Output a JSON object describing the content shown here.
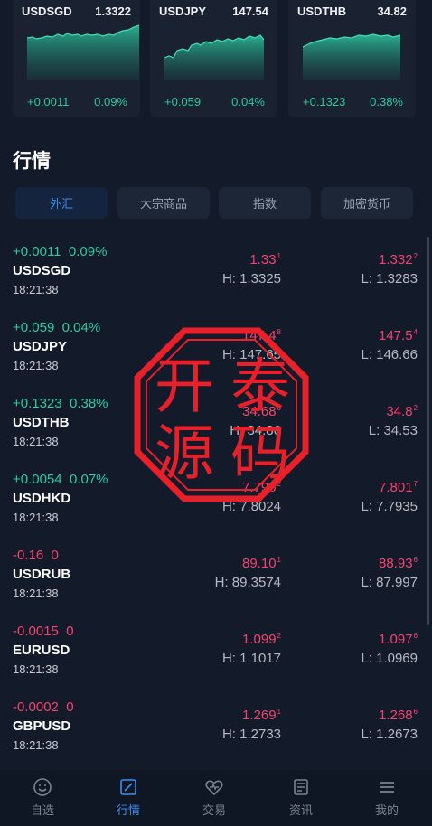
{
  "cards": [
    {
      "symbol": "USDSGD",
      "price": "1.3322",
      "change": "+0.0011",
      "percent": "0.09%"
    },
    {
      "symbol": "USDJPY",
      "price": "147.54",
      "change": "+0.059",
      "percent": "0.04%"
    },
    {
      "symbol": "USDTHB",
      "price": "34.82",
      "change": "+0.1323",
      "percent": "0.38%"
    }
  ],
  "section_title": "行情",
  "tabs": [
    "外汇",
    "大宗商品",
    "指数",
    "加密货币"
  ],
  "rows": [
    {
      "change": "+0.0011",
      "percent": "0.09%",
      "symbol": "USDSGD",
      "time": "18:21:38",
      "bid": "1.33",
      "bid_sup": "1",
      "ask": "1.332",
      "ask_sup": "2",
      "high": "H: 1.3325",
      "low": "L: 1.3283"
    },
    {
      "change": "+0.059",
      "percent": "0.04%",
      "symbol": "USDJPY",
      "time": "18:21:38",
      "bid": "147.4",
      "bid_sup": "8",
      "ask": "147.5",
      "ask_sup": "4",
      "high": "H: 147.65",
      "low": "L: 146.66"
    },
    {
      "change": "+0.1323",
      "percent": "0.38%",
      "symbol": "USDTHB",
      "time": "18:21:38",
      "bid": "34.68",
      "bid_sup": "8",
      "ask": "34.8",
      "ask_sup": "2",
      "high": "H: 34.86",
      "low": "L: 34.53"
    },
    {
      "change": "+0.0054",
      "percent": "0.07%",
      "symbol": "USDHKD",
      "time": "18:21:38",
      "bid": "7.796",
      "bid_sup": "2",
      "ask": "7.801",
      "ask_sup": "7",
      "high": "H: 7.8024",
      "low": "L: 7.7935"
    },
    {
      "change": "-0.16",
      "percent": "0",
      "symbol": "USDRUB",
      "time": "18:21:38",
      "bid": "89.10",
      "bid_sup": "1",
      "ask": "88.93",
      "ask_sup": "6",
      "high": "H: 89.3574",
      "low": "L: 87.997"
    },
    {
      "change": "-0.0015",
      "percent": "0",
      "symbol": "EURUSD",
      "time": "18:21:38",
      "bid": "1.099",
      "bid_sup": "2",
      "ask": "1.097",
      "ask_sup": "6",
      "high": "H: 1.1017",
      "low": "L: 1.0969"
    },
    {
      "change": "-0.0002",
      "percent": "0",
      "symbol": "GBPUSD",
      "time": "18:21:38",
      "bid": "1.269",
      "bid_sup": "1",
      "ask": "1.268",
      "ask_sup": "6",
      "high": "H: 1.2733",
      "low": "L: 1.2673"
    }
  ],
  "watermark": {
    "line1_left": "开",
    "line1_right": "泰",
    "line2_left": "源",
    "line2_right": "码"
  },
  "nav": [
    {
      "label": "自选",
      "icon": "smiley-icon"
    },
    {
      "label": "行情",
      "icon": "chart-icon"
    },
    {
      "label": "交易",
      "icon": "heart-pulse-icon"
    },
    {
      "label": "资讯",
      "icon": "news-icon"
    },
    {
      "label": "我的",
      "icon": "menu-icon"
    }
  ],
  "colors": {
    "up": "#2dc9a0",
    "down": "#f0456e",
    "accent": "#3e8ef0",
    "stamp": "#e8202a"
  }
}
